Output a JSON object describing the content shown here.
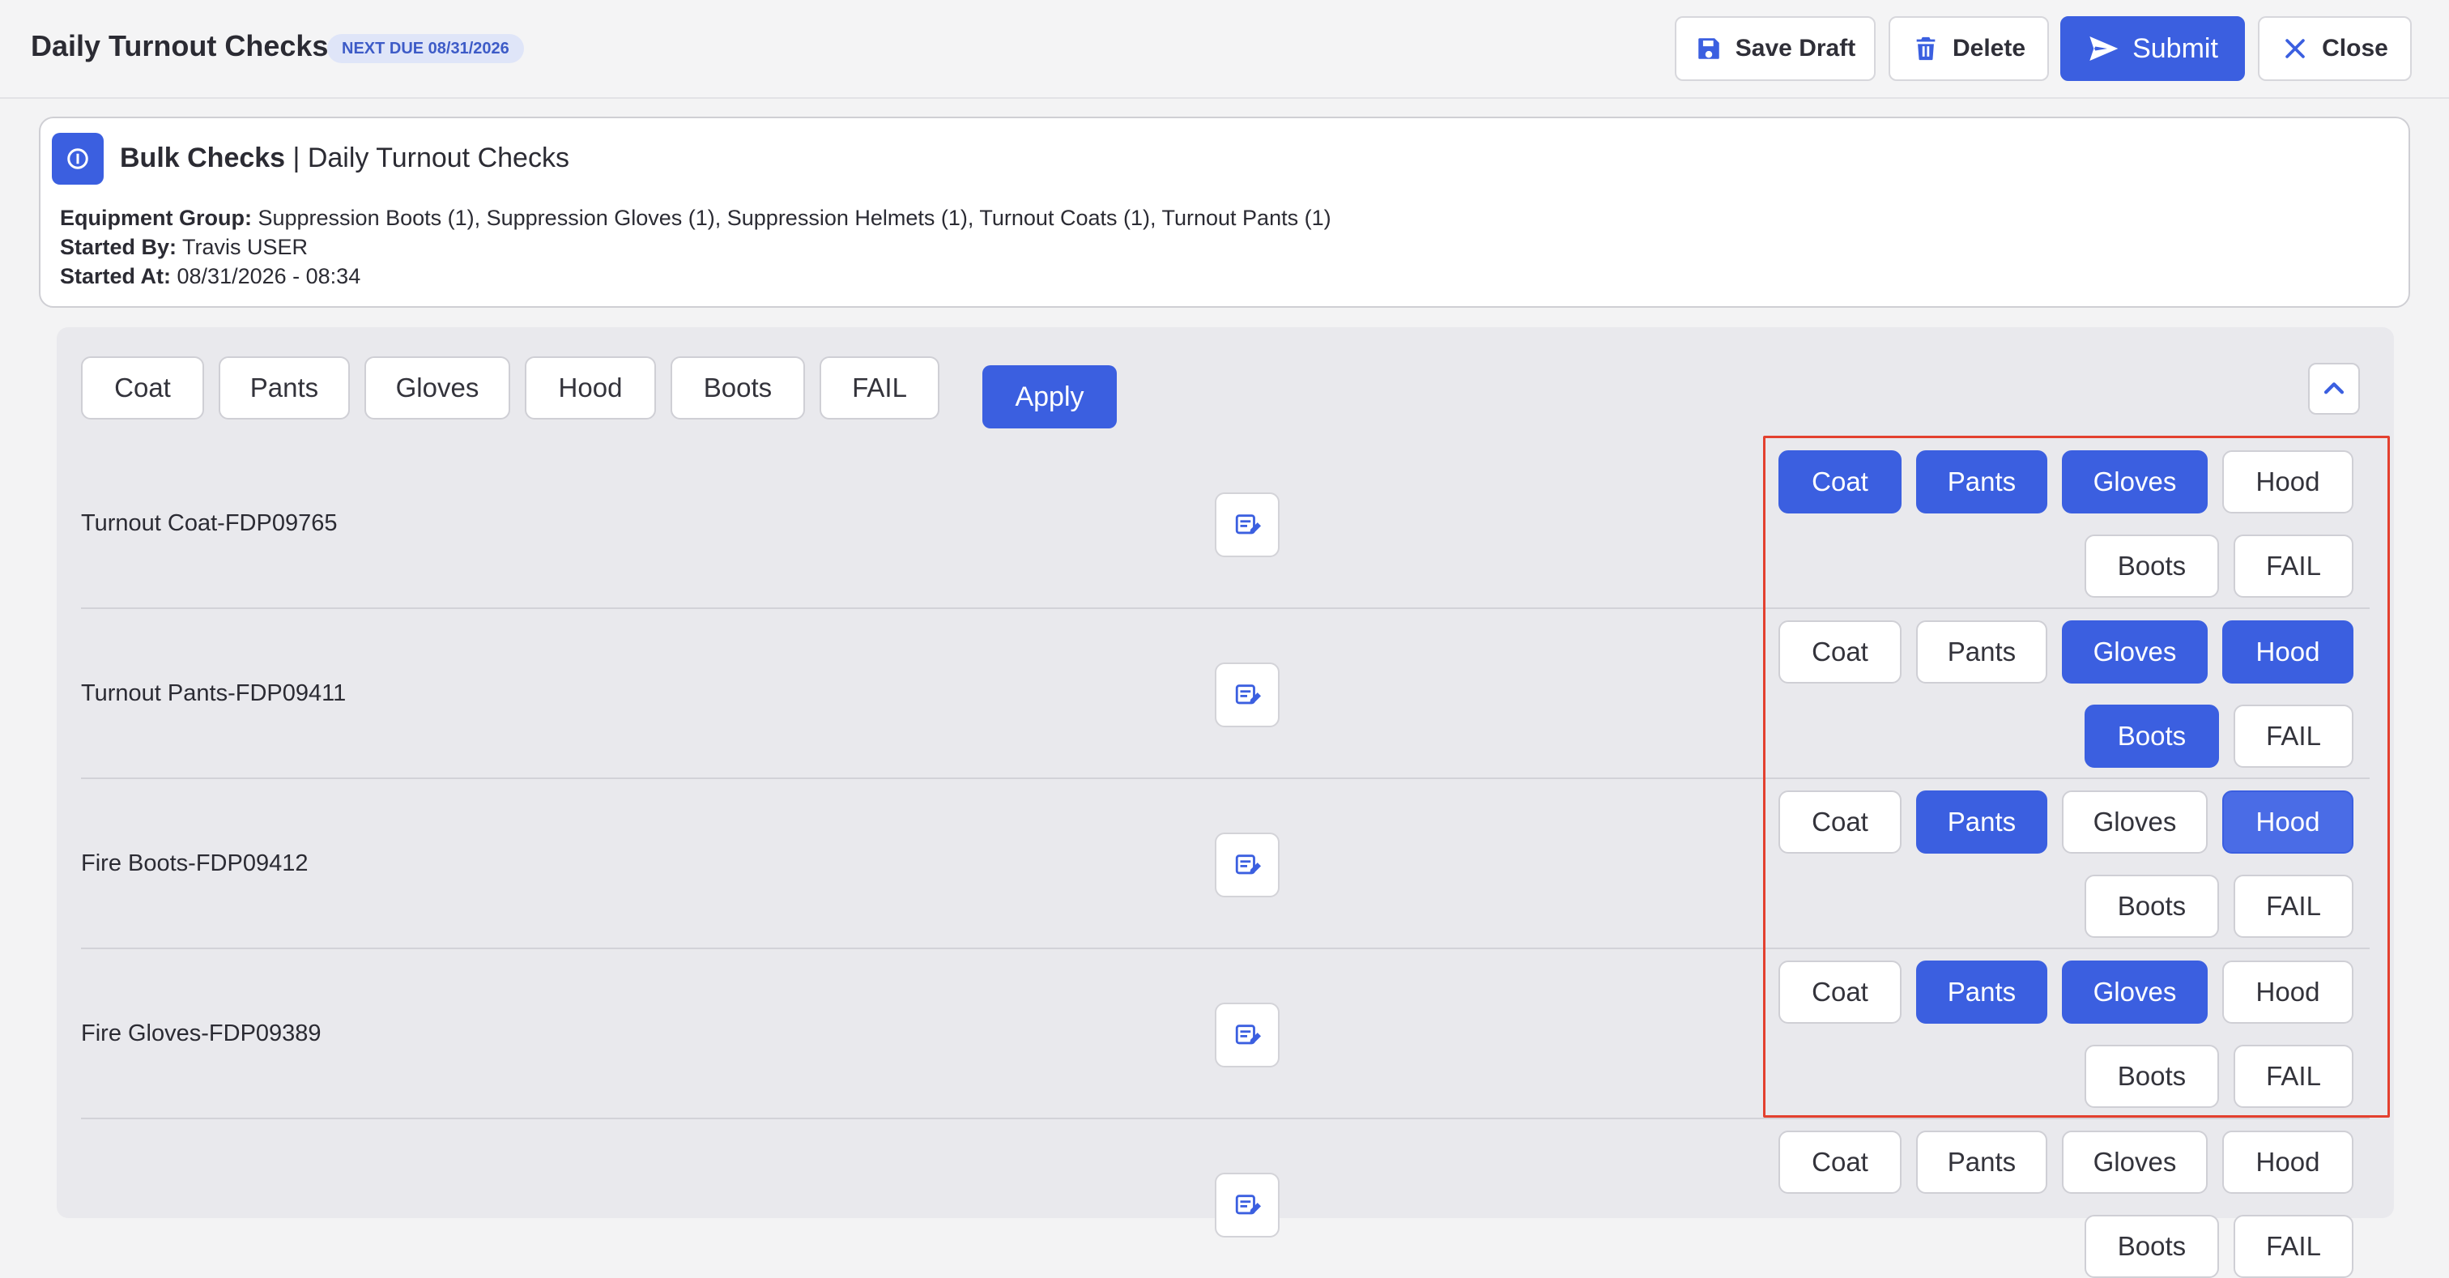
{
  "header": {
    "title": "Daily Turnout Checks",
    "due_badge": "NEXT DUE 08/31/2026",
    "buttons": {
      "save_draft": "Save Draft",
      "delete": "Delete",
      "submit": "Submit",
      "close": "Close"
    }
  },
  "info": {
    "heading_bold": "Bulk Checks",
    "heading_rest": " | Daily Turnout Checks",
    "equipment_label": "Equipment Group:",
    "equipment_value": " Suppression Boots (1), Suppression Gloves (1), Suppression Helmets (1), Turnout Coats (1), Turnout Pants (1)",
    "started_by_label": "Started By:",
    "started_by_value": " Travis USER",
    "started_at_label": "Started At:",
    "started_at_value": " 08/31/2026 - 08:34"
  },
  "bulk_bar": {
    "chips": [
      "Coat",
      "Pants",
      "Gloves",
      "Hood",
      "Boots",
      "FAIL"
    ],
    "apply": "Apply"
  },
  "rows": [
    {
      "label": "Turnout Coat-FDP09765",
      "selected": [
        "Coat",
        "Pants",
        "Gloves"
      ]
    },
    {
      "label": "Turnout Pants-FDP09411",
      "selected": [
        "Gloves",
        "Hood",
        "Boots"
      ]
    },
    {
      "label": "Fire Boots-FDP09412",
      "selected": [
        "Pants",
        "Hood"
      ]
    },
    {
      "label": "Fire Gloves-FDP09389",
      "selected": [
        "Pants",
        "Gloves"
      ]
    },
    {
      "label": "",
      "selected": []
    }
  ],
  "colors": {
    "accent": "#3b5fe0",
    "highlight": "#e3402f"
  }
}
